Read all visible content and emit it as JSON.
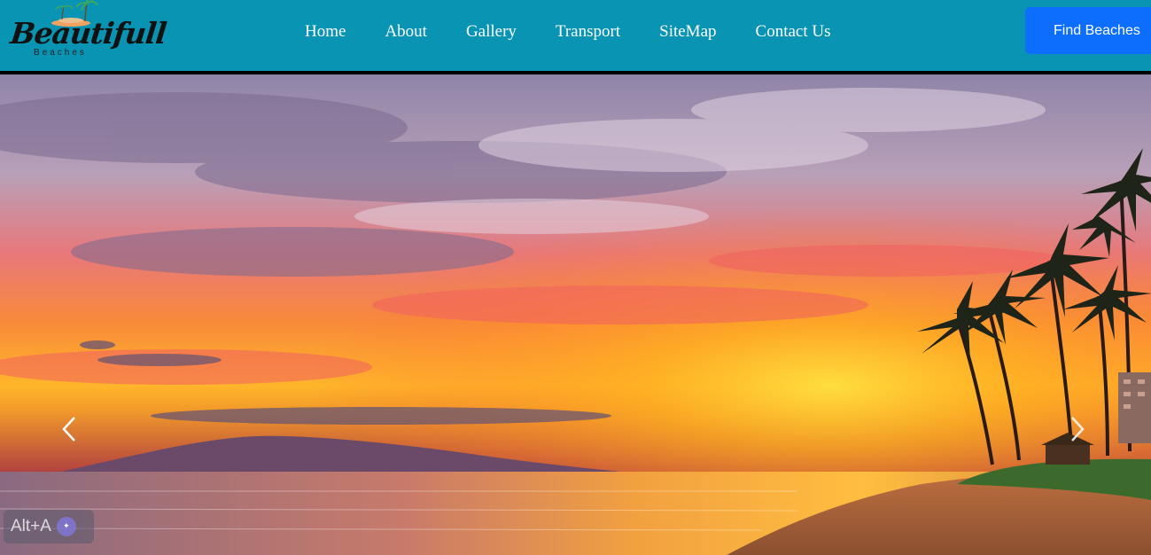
{
  "brand": {
    "name": "Beautifull",
    "tagline": "Beaches"
  },
  "nav": {
    "items": [
      {
        "label": "Home"
      },
      {
        "label": "About"
      },
      {
        "label": "Gallery"
      },
      {
        "label": "Transport"
      },
      {
        "label": "SiteMap"
      },
      {
        "label": "Contact Us"
      }
    ]
  },
  "cta": {
    "label": "Find Beaches"
  },
  "carousel": {
    "prev_icon": "chevron-left-icon",
    "next_icon": "chevron-right-icon"
  },
  "overlay": {
    "shortcut_label": "Alt+A"
  },
  "colors": {
    "navbar_bg": "#0894b2",
    "cta_bg": "#0d6efd",
    "nav_text": "#ffffff"
  }
}
